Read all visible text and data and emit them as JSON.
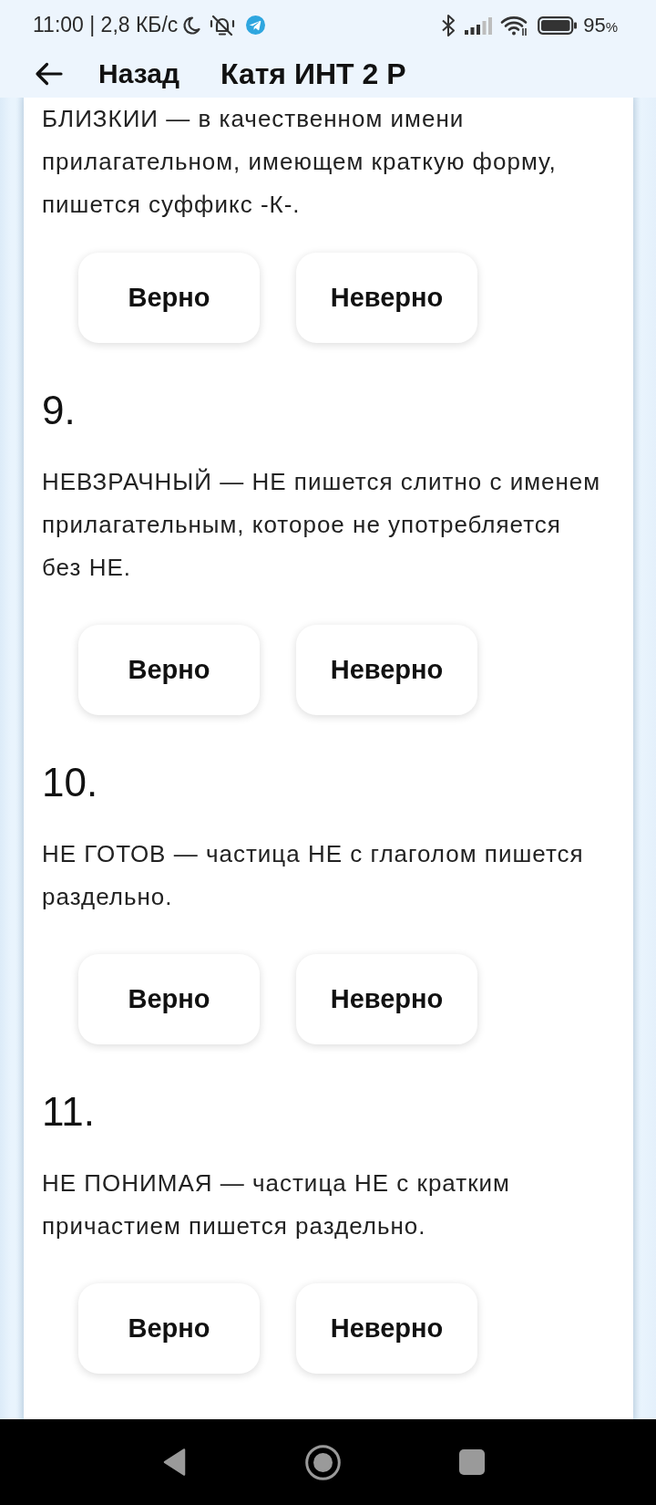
{
  "status_bar": {
    "clock_speed": "11:00 | 2,8 КБ/с",
    "battery_percent": "95",
    "battery_unit": "%"
  },
  "header": {
    "back_label": "Назад",
    "title": "Катя ИНТ 2 Р"
  },
  "questions": [
    {
      "statement": "БЛИЗКИИ — в качественном имени прилагательном, имеющем краткую форму, пишется суффикс -К-.",
      "options": [
        "Верно",
        "Неверно"
      ]
    },
    {
      "number": "9.",
      "statement": "НЕВЗРАЧНЫЙ — НЕ пишется слитно с именем прилагательным, которое не употребляется без НЕ.",
      "options": [
        "Верно",
        "Неверно"
      ]
    },
    {
      "number": "10.",
      "statement": "НЕ ГОТОВ — частица НЕ с глаголом пишется раздельно.",
      "options": [
        "Верно",
        "Неверно"
      ]
    },
    {
      "number": "11.",
      "statement": "НЕ ПОНИМАЯ — частица НЕ с кратким причастием пишется раздельно.",
      "options": [
        "Верно",
        "Неверно"
      ]
    }
  ]
}
